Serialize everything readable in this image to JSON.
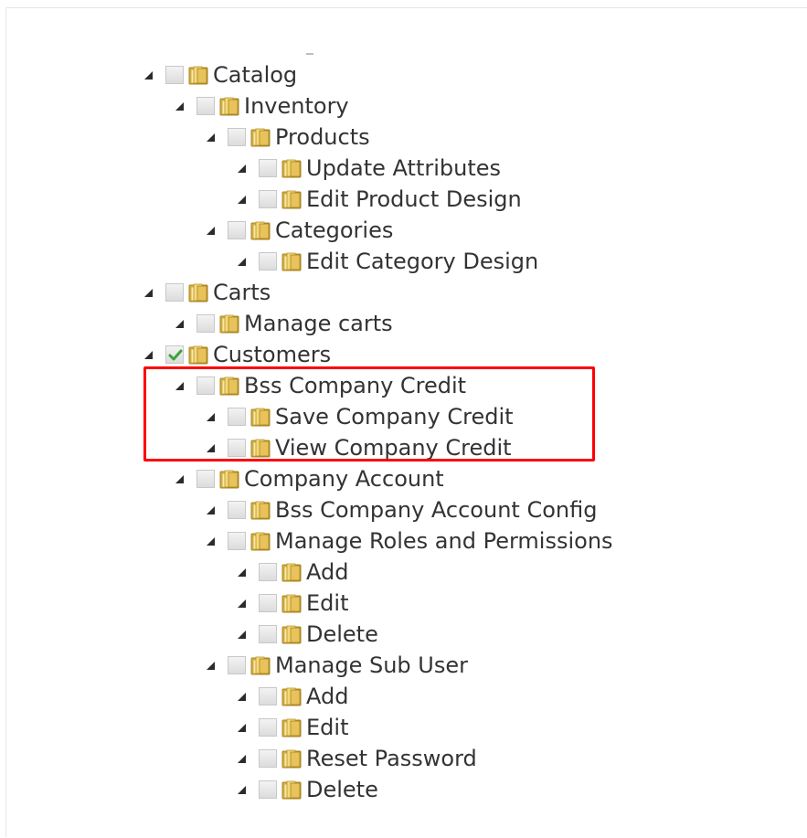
{
  "tree": {
    "nodes": [
      {
        "label": "Catalog",
        "depth": 0,
        "checked": false
      },
      {
        "label": "Inventory",
        "depth": 1,
        "checked": false
      },
      {
        "label": "Products",
        "depth": 2,
        "checked": false
      },
      {
        "label": "Update Attributes",
        "depth": 3,
        "checked": false
      },
      {
        "label": "Edit Product Design",
        "depth": 3,
        "checked": false
      },
      {
        "label": "Categories",
        "depth": 2,
        "checked": false
      },
      {
        "label": "Edit Category Design",
        "depth": 3,
        "checked": false
      },
      {
        "label": "Carts",
        "depth": 0,
        "checked": false
      },
      {
        "label": "Manage carts",
        "depth": 1,
        "checked": false
      },
      {
        "label": "Customers",
        "depth": 0,
        "checked": true
      },
      {
        "label": "Bss Company Credit",
        "depth": 1,
        "checked": false
      },
      {
        "label": "Save Company Credit",
        "depth": 2,
        "checked": false
      },
      {
        "label": "View Company Credit",
        "depth": 2,
        "checked": false
      },
      {
        "label": "Company Account",
        "depth": 1,
        "checked": false
      },
      {
        "label": "Bss Company Account Config",
        "depth": 2,
        "checked": false
      },
      {
        "label": "Manage Roles and Permissions",
        "depth": 2,
        "checked": false
      },
      {
        "label": "Add",
        "depth": 3,
        "checked": false
      },
      {
        "label": "Edit",
        "depth": 3,
        "checked": false
      },
      {
        "label": "Delete",
        "depth": 3,
        "checked": false
      },
      {
        "label": "Manage Sub User",
        "depth": 2,
        "checked": false
      },
      {
        "label": "Add",
        "depth": 3,
        "checked": false
      },
      {
        "label": "Edit",
        "depth": 3,
        "checked": false
      },
      {
        "label": "Reset Password",
        "depth": 3,
        "checked": false
      },
      {
        "label": "Delete",
        "depth": 3,
        "checked": false
      }
    ]
  },
  "colors": {
    "highlight": "#ff0000",
    "check": "#3aa33a",
    "folder": "#e8c25a",
    "text": "#333333"
  },
  "icons": {
    "toggle": "expanded-triangle-icon",
    "checkbox": "checkbox-icon",
    "folder": "folder-icon"
  }
}
